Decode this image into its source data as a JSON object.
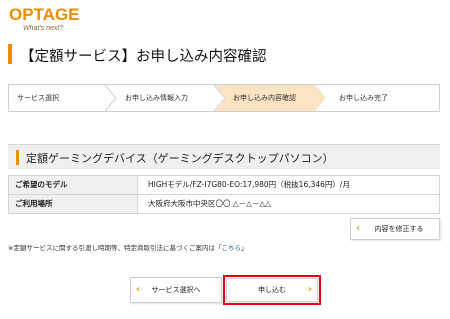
{
  "brand": {
    "logo_text": "OPTAGE",
    "tagline": "What's next?",
    "accent": "#f08c00"
  },
  "page_title": "【定額サービス】お申し込み内容確認",
  "steps": [
    {
      "label": "サービス選択",
      "active": false
    },
    {
      "label": "お申し込み情報入力",
      "active": false
    },
    {
      "label": "お申し込み内容確認",
      "active": true
    },
    {
      "label": "お申し込み完了",
      "active": false
    }
  ],
  "section_title": "定額ゲーミングデバイス（ゲーミングデスクトップパソコン）",
  "details": [
    {
      "label": "ご希望のモデル",
      "value": "HIGHモデル/FZ-I7G80-EO:17,980円（税抜16,346円）/月"
    },
    {
      "label": "ご利用場所",
      "value": "大阪府大阪市中央区〇〇 △－△－△△"
    }
  ],
  "buttons": {
    "modify": "内容を修正する",
    "back": "サービス選択へ",
    "submit": "申し込む"
  },
  "note": {
    "text": "※定額サービスに関する引渡し時期等、特定商取引法に基づくご案内は「",
    "link": "こちら",
    "suffix": "」"
  },
  "colors": {
    "highlight": "#e60012",
    "active_step": "#fbe3c4",
    "arrow": "#f0a000"
  }
}
